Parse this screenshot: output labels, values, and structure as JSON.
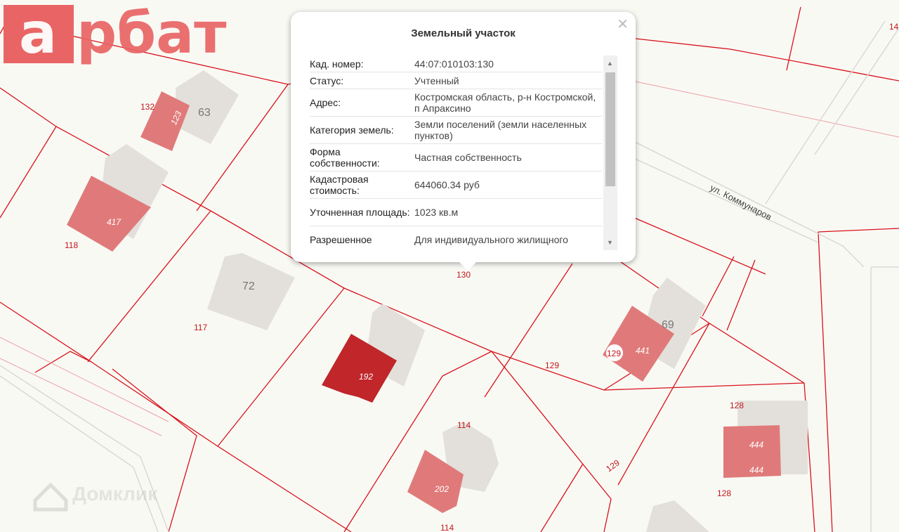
{
  "logo": {
    "text": "арбат",
    "color": "#e96565"
  },
  "popup": {
    "title": "Земельный участок",
    "close_icon": "close-icon",
    "rows": [
      {
        "key": "Кад. номер:",
        "value": "44:07:010103:130"
      },
      {
        "key": "Статус:",
        "value": "Учтенный"
      },
      {
        "key": "Адрес:",
        "value": "Костромская область, р-н Костромской, п Апраксино"
      },
      {
        "key": "Категория земель:",
        "value": "Земли поселений (земли населенных пунктов)"
      },
      {
        "key": "Форма собственности:",
        "value": "Частная собственность"
      },
      {
        "key": "Кадастровая стоимость:",
        "value": "644060.34 руб"
      },
      {
        "key": "Уточненная площадь:",
        "value": "1023 кв.м"
      },
      {
        "key": "Разрешенное",
        "value": "Для индивидуального жилищного"
      }
    ]
  },
  "map": {
    "street": "ул. Коммунаров",
    "watermark": "Домклик",
    "parcel_labels": [
      "132",
      "118",
      "117",
      "130",
      "114",
      "114",
      "129",
      "129",
      "128",
      "128",
      "129",
      "14"
    ],
    "building_labels": [
      "123",
      "417",
      "192",
      "202",
      "441",
      "444",
      "444"
    ],
    "house_numbers": [
      "63",
      "72",
      "69"
    ],
    "colors": {
      "boundary": "#d9121b",
      "selected": "#c0262a",
      "building": "#e07a7a",
      "house": "#e3e0db"
    }
  }
}
